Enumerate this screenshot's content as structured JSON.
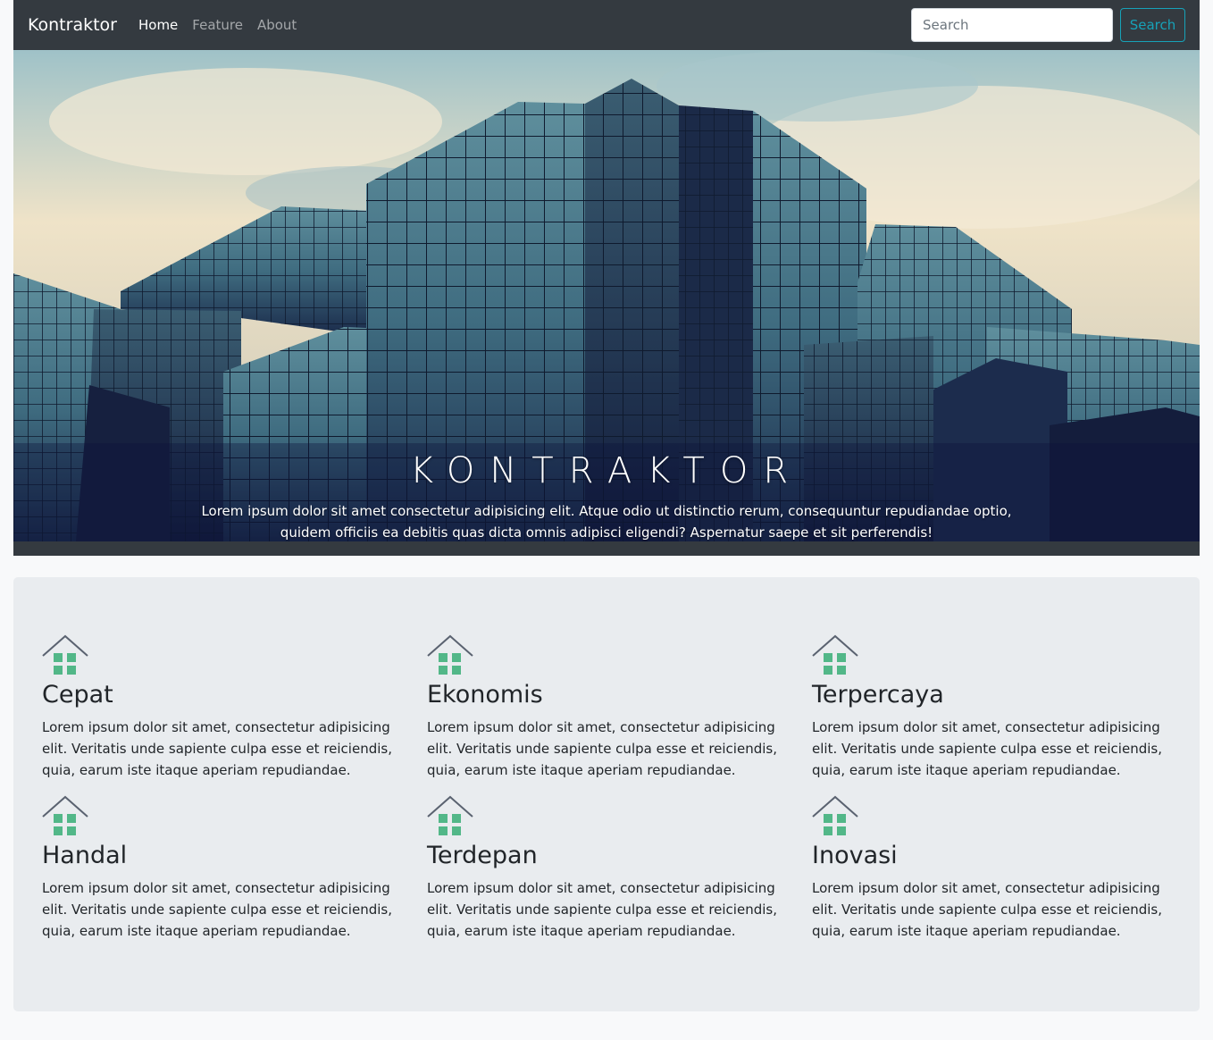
{
  "navbar": {
    "brand": "Kontraktor",
    "links": [
      {
        "label": "Home"
      },
      {
        "label": "Feature"
      },
      {
        "label": "About"
      }
    ],
    "search": {
      "placeholder": "Search",
      "button_label": "Search"
    }
  },
  "hero": {
    "title": "KONTRAKTOR",
    "text": "Lorem ipsum dolor sit amet consectetur adipisicing elit. Atque odio ut distinctio rerum, consequuntur repudiandae optio, quidem officiis ea debitis quas dicta omnis adipisci eligendi? Aspernatur saepe et sit perferendis!"
  },
  "features": [
    {
      "title": "Cepat",
      "text": "Lorem ipsum dolor sit amet, consectetur adipisicing elit. Veritatis unde sapiente culpa esse et reiciendis, quia, earum iste itaque aperiam repudiandae.",
      "icon": "house-icon"
    },
    {
      "title": "Ekonomis",
      "text": "Lorem ipsum dolor sit amet, consectetur adipisicing elit. Veritatis unde sapiente culpa esse et reiciendis, quia, earum iste itaque aperiam repudiandae.",
      "icon": "house-icon"
    },
    {
      "title": "Terpercaya",
      "text": "Lorem ipsum dolor sit amet, consectetur adipisicing elit. Veritatis unde sapiente culpa esse et reiciendis, quia, earum iste itaque aperiam repudiandae.",
      "icon": "house-icon"
    },
    {
      "title": "Handal",
      "text": "Lorem ipsum dolor sit amet, consectetur adipisicing elit. Veritatis unde sapiente culpa esse et reiciendis, quia, earum iste itaque aperiam repudiandae.",
      "icon": "house-icon"
    },
    {
      "title": "Terdepan",
      "text": "Lorem ipsum dolor sit amet, consectetur adipisicing elit. Veritatis unde sapiente culpa esse et reiciendis, quia, earum iste itaque aperiam repudiandae.",
      "icon": "house-icon"
    },
    {
      "title": "Inovasi",
      "text": "Lorem ipsum dolor sit amet, consectetur adipisicing elit. Veritatis unde sapiente culpa esse et reiciendis, quia, earum iste itaque aperiam repudiandae.",
      "icon": "house-icon"
    }
  ],
  "colors": {
    "navbar_bg": "#343a40",
    "accent": "#17a2b8",
    "icon_green": "#52b788",
    "features_bg": "#e9ecef"
  }
}
